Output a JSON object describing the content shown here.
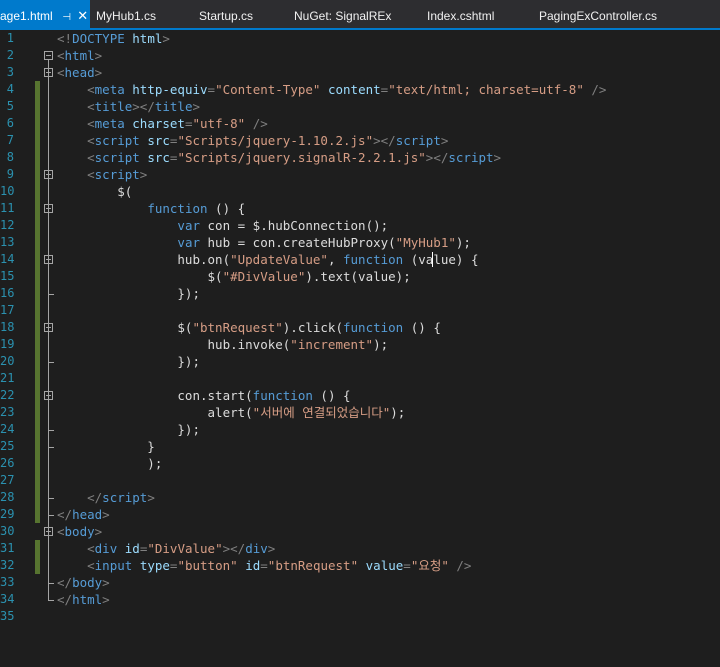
{
  "tabs": [
    {
      "label": "age1.html",
      "active": true,
      "pin": "⊣",
      "close": "✕"
    },
    {
      "label": "MyHub1.cs"
    },
    {
      "label": "Startup.cs"
    },
    {
      "label": "NuGet: SignalREx"
    },
    {
      "label": "Index.cshtml"
    },
    {
      "label": "PagingExController.cs"
    }
  ],
  "colors": {
    "accent": "#007acc",
    "keyword": "#569cd6",
    "string": "#d69d85",
    "attribute": "#9cdcfe",
    "line_number": "#2b91af",
    "change_bar": "#577430"
  },
  "lines": [
    {
      "n": "1",
      "segs": [
        {
          "c": "t-gray",
          "t": "<!"
        },
        {
          "c": "t-tag",
          "t": "DOCTYPE"
        },
        {
          "c": "",
          "t": " "
        },
        {
          "c": "t-attr",
          "t": "html"
        },
        {
          "c": "t-gray",
          "t": ">"
        }
      ]
    },
    {
      "n": "2",
      "segs": [
        {
          "c": "t-gray",
          "t": "<"
        },
        {
          "c": "t-tag",
          "t": "html"
        },
        {
          "c": "t-gray",
          "t": ">"
        }
      ]
    },
    {
      "n": "3",
      "segs": [
        {
          "c": "t-gray",
          "t": "<"
        },
        {
          "c": "t-tag",
          "t": "head"
        },
        {
          "c": "t-gray",
          "t": ">"
        }
      ]
    },
    {
      "n": "4",
      "segs": [
        {
          "c": "",
          "t": "    "
        },
        {
          "c": "t-gray",
          "t": "<"
        },
        {
          "c": "t-tag",
          "t": "meta"
        },
        {
          "c": "",
          "t": " "
        },
        {
          "c": "t-attr",
          "t": "http-equiv"
        },
        {
          "c": "t-gray",
          "t": "="
        },
        {
          "c": "t-str",
          "t": "\"Content-Type\""
        },
        {
          "c": "",
          "t": " "
        },
        {
          "c": "t-attr",
          "t": "content"
        },
        {
          "c": "t-gray",
          "t": "="
        },
        {
          "c": "t-str",
          "t": "\"text/html; charset=utf-8\""
        },
        {
          "c": "",
          "t": " "
        },
        {
          "c": "t-gray",
          "t": "/>"
        }
      ]
    },
    {
      "n": "5",
      "segs": [
        {
          "c": "",
          "t": "    "
        },
        {
          "c": "t-gray",
          "t": "<"
        },
        {
          "c": "t-tag",
          "t": "title"
        },
        {
          "c": "t-gray",
          "t": "></"
        },
        {
          "c": "t-tag",
          "t": "title"
        },
        {
          "c": "t-gray",
          "t": ">"
        }
      ]
    },
    {
      "n": "6",
      "segs": [
        {
          "c": "",
          "t": "    "
        },
        {
          "c": "t-gray",
          "t": "<"
        },
        {
          "c": "t-tag",
          "t": "meta"
        },
        {
          "c": "",
          "t": " "
        },
        {
          "c": "t-attr",
          "t": "charset"
        },
        {
          "c": "t-gray",
          "t": "="
        },
        {
          "c": "t-str",
          "t": "\"utf-8\""
        },
        {
          "c": "",
          "t": " "
        },
        {
          "c": "t-gray",
          "t": "/>"
        }
      ]
    },
    {
      "n": "7",
      "segs": [
        {
          "c": "",
          "t": "    "
        },
        {
          "c": "t-gray",
          "t": "<"
        },
        {
          "c": "t-tag",
          "t": "script"
        },
        {
          "c": "",
          "t": " "
        },
        {
          "c": "t-attr",
          "t": "src"
        },
        {
          "c": "t-gray",
          "t": "="
        },
        {
          "c": "t-str",
          "t": "\"Scripts/jquery-1.10.2.js\""
        },
        {
          "c": "t-gray",
          "t": "></"
        },
        {
          "c": "t-tag",
          "t": "script"
        },
        {
          "c": "t-gray",
          "t": ">"
        }
      ]
    },
    {
      "n": "8",
      "segs": [
        {
          "c": "",
          "t": "    "
        },
        {
          "c": "t-gray",
          "t": "<"
        },
        {
          "c": "t-tag",
          "t": "script"
        },
        {
          "c": "",
          "t": " "
        },
        {
          "c": "t-attr",
          "t": "src"
        },
        {
          "c": "t-gray",
          "t": "="
        },
        {
          "c": "t-str",
          "t": "\"Scripts/jquery.signalR-2.2.1.js\""
        },
        {
          "c": "t-gray",
          "t": "></"
        },
        {
          "c": "t-tag",
          "t": "script"
        },
        {
          "c": "t-gray",
          "t": ">"
        }
      ]
    },
    {
      "n": "9",
      "segs": [
        {
          "c": "",
          "t": "    "
        },
        {
          "c": "t-gray",
          "t": "<"
        },
        {
          "c": "t-tag",
          "t": "script"
        },
        {
          "c": "t-gray",
          "t": ">"
        }
      ]
    },
    {
      "n": "10",
      "segs": [
        {
          "c": "",
          "t": "        $("
        }
      ]
    },
    {
      "n": "11",
      "segs": [
        {
          "c": "",
          "t": "            "
        },
        {
          "c": "t-kw",
          "t": "function"
        },
        {
          "c": "",
          "t": " () {"
        }
      ]
    },
    {
      "n": "12",
      "segs": [
        {
          "c": "",
          "t": "                "
        },
        {
          "c": "t-kw",
          "t": "var"
        },
        {
          "c": "",
          "t": " con = $.hubConnection();"
        }
      ]
    },
    {
      "n": "13",
      "segs": [
        {
          "c": "",
          "t": "                "
        },
        {
          "c": "t-kw",
          "t": "var"
        },
        {
          "c": "",
          "t": " hub = con.createHubProxy("
        },
        {
          "c": "t-str",
          "t": "\"MyHub1\""
        },
        {
          "c": "",
          "t": ");"
        }
      ]
    },
    {
      "n": "14",
      "segs": [
        {
          "c": "",
          "t": "                hub.on("
        },
        {
          "c": "t-str",
          "t": "\"UpdateValue\""
        },
        {
          "c": "",
          "t": ", "
        },
        {
          "c": "t-kw",
          "t": "function"
        },
        {
          "c": "",
          "t": " (value) {"
        }
      ]
    },
    {
      "n": "15",
      "segs": [
        {
          "c": "",
          "t": "                    $("
        },
        {
          "c": "t-str",
          "t": "\"#DivValue\""
        },
        {
          "c": "",
          "t": ").text(value);"
        }
      ]
    },
    {
      "n": "16",
      "segs": [
        {
          "c": "",
          "t": "                });"
        }
      ]
    },
    {
      "n": "17",
      "segs": []
    },
    {
      "n": "18",
      "segs": [
        {
          "c": "",
          "t": "                $("
        },
        {
          "c": "t-str",
          "t": "\"btnRequest\""
        },
        {
          "c": "",
          "t": ").click("
        },
        {
          "c": "t-kw",
          "t": "function"
        },
        {
          "c": "",
          "t": " () {"
        }
      ]
    },
    {
      "n": "19",
      "segs": [
        {
          "c": "",
          "t": "                    hub.invoke("
        },
        {
          "c": "t-str",
          "t": "\"increment\""
        },
        {
          "c": "",
          "t": ");"
        }
      ]
    },
    {
      "n": "20",
      "segs": [
        {
          "c": "",
          "t": "                });"
        }
      ]
    },
    {
      "n": "21",
      "segs": []
    },
    {
      "n": "22",
      "segs": [
        {
          "c": "",
          "t": "                con.start("
        },
        {
          "c": "t-kw",
          "t": "function"
        },
        {
          "c": "",
          "t": " () {"
        }
      ]
    },
    {
      "n": "23",
      "segs": [
        {
          "c": "",
          "t": "                    alert("
        },
        {
          "c": "t-str",
          "t": "\"서버에 연결되었습니다\""
        },
        {
          "c": "",
          "t": ");"
        }
      ]
    },
    {
      "n": "24",
      "segs": [
        {
          "c": "",
          "t": "                });"
        }
      ]
    },
    {
      "n": "25",
      "segs": [
        {
          "c": "",
          "t": "            }"
        }
      ]
    },
    {
      "n": "26",
      "segs": [
        {
          "c": "",
          "t": "            );"
        }
      ]
    },
    {
      "n": "27",
      "segs": []
    },
    {
      "n": "28",
      "segs": [
        {
          "c": "",
          "t": "    "
        },
        {
          "c": "t-gray",
          "t": "</"
        },
        {
          "c": "t-tag",
          "t": "script"
        },
        {
          "c": "t-gray",
          "t": ">"
        }
      ]
    },
    {
      "n": "29",
      "segs": [
        {
          "c": "t-gray",
          "t": "</"
        },
        {
          "c": "t-tag",
          "t": "head"
        },
        {
          "c": "t-gray",
          "t": ">"
        }
      ]
    },
    {
      "n": "30",
      "segs": [
        {
          "c": "t-gray",
          "t": "<"
        },
        {
          "c": "t-tag",
          "t": "body"
        },
        {
          "c": "t-gray",
          "t": ">"
        }
      ]
    },
    {
      "n": "31",
      "segs": [
        {
          "c": "",
          "t": "    "
        },
        {
          "c": "t-gray",
          "t": "<"
        },
        {
          "c": "t-tag",
          "t": "div"
        },
        {
          "c": "",
          "t": " "
        },
        {
          "c": "t-attr",
          "t": "id"
        },
        {
          "c": "t-gray",
          "t": "="
        },
        {
          "c": "t-str",
          "t": "\"DivValue\""
        },
        {
          "c": "t-gray",
          "t": "></"
        },
        {
          "c": "t-tag",
          "t": "div"
        },
        {
          "c": "t-gray",
          "t": ">"
        }
      ]
    },
    {
      "n": "32",
      "segs": [
        {
          "c": "",
          "t": "    "
        },
        {
          "c": "t-gray",
          "t": "<"
        },
        {
          "c": "t-tag",
          "t": "input"
        },
        {
          "c": "",
          "t": " "
        },
        {
          "c": "t-attr",
          "t": "type"
        },
        {
          "c": "t-gray",
          "t": "="
        },
        {
          "c": "t-str",
          "t": "\"button\""
        },
        {
          "c": "",
          "t": " "
        },
        {
          "c": "t-attr",
          "t": "id"
        },
        {
          "c": "t-gray",
          "t": "="
        },
        {
          "c": "t-str",
          "t": "\"btnRequest\""
        },
        {
          "c": "",
          "t": " "
        },
        {
          "c": "t-attr",
          "t": "value"
        },
        {
          "c": "t-gray",
          "t": "="
        },
        {
          "c": "t-str",
          "t": "\"요청\""
        },
        {
          "c": "",
          "t": " "
        },
        {
          "c": "t-gray",
          "t": "/>"
        }
      ]
    },
    {
      "n": "33",
      "segs": [
        {
          "c": "t-gray",
          "t": "</"
        },
        {
          "c": "t-tag",
          "t": "body"
        },
        {
          "c": "t-gray",
          "t": ">"
        }
      ]
    },
    {
      "n": "34",
      "segs": [
        {
          "c": "t-gray",
          "t": "</"
        },
        {
          "c": "t-tag",
          "t": "html"
        },
        {
          "c": "t-gray",
          "t": ">"
        }
      ]
    },
    {
      "n": "35",
      "segs": []
    }
  ]
}
